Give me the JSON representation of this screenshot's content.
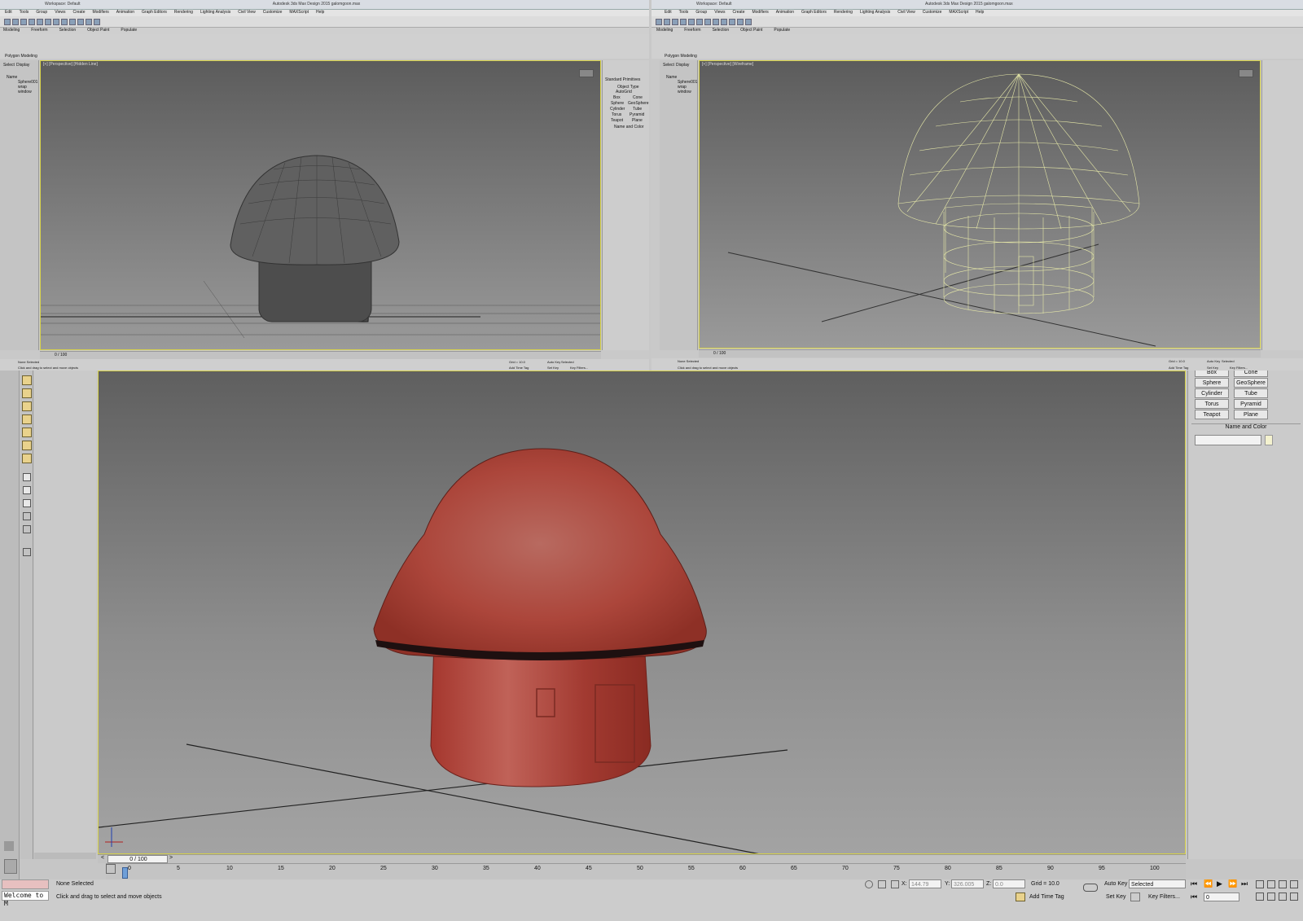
{
  "left_panel": {
    "title": "Autodesk 3ds Max Design 2015   galomgoon.max",
    "workspace": "Workspace: Default",
    "menus": [
      "Edit",
      "Tools",
      "Group",
      "Views",
      "Create",
      "Modifiers",
      "Animation",
      "Graph Editors",
      "Rendering",
      "Lighting Analysis",
      "Civil View",
      "Customize",
      "MAXScript",
      "Help"
    ],
    "ribbon_tabs": [
      "Modeling",
      "Freeform",
      "Selection",
      "Object Paint",
      "Populate"
    ],
    "ribbon_label": "Polygon Modeling",
    "scene_tabs": [
      "Select",
      "Display"
    ],
    "scene_header": "Name",
    "scene_items": [
      "Sphere001",
      "wrap window"
    ],
    "viewport_label": "[+] [Perspective] [Hidden Line]",
    "cmd_category": "Standard Primitives",
    "cmd_rollout": "Object Type",
    "cmd_autogrid": "AutoGrid",
    "cmd_buttons": [
      "Box",
      "Cone",
      "Sphere",
      "GeoSphere",
      "Cylinder",
      "Tube",
      "Torus",
      "Pyramid",
      "Teapot",
      "Plane"
    ],
    "cmd_namecolor": "Name and Color",
    "frame": "0 / 100",
    "status": "None Selected",
    "prompt": "Click and drag to select and move objects",
    "grid": "Grid = 10.0",
    "autokey": "Auto Key",
    "selected": "Selected",
    "setkey": "Set Key",
    "keyfilters": "Key Filters...",
    "timetag": "Add Time Tag"
  },
  "right_panel": {
    "title": "Autodesk 3ds Max Design 2015   galomgoon.max",
    "workspace": "Workspace: Default",
    "menus": [
      "Edit",
      "Tools",
      "Group",
      "Views",
      "Create",
      "Modifiers",
      "Animation",
      "Graph Editors",
      "Rendering",
      "Lighting Analysis",
      "Civil View",
      "Customize",
      "MAXScript",
      "Help"
    ],
    "ribbon_tabs": [
      "Modeling",
      "Freeform",
      "Selection",
      "Object Paint",
      "Populate"
    ],
    "ribbon_label": "Polygon Modeling",
    "scene_tabs": [
      "Select",
      "Display"
    ],
    "scene_header": "Name",
    "scene_items": [
      "Sphere001",
      "wrap window"
    ],
    "viewport_label": "[+] [Perspective] [Wireframe]",
    "frame": "0 / 100",
    "status": "None Selected",
    "prompt": "Click and drag to select and move objects",
    "grid": "Grid = 10.0",
    "autokey": "Auto Key",
    "selected": "Selected",
    "setkey": "Set Key",
    "keyfilters": "Key Filters...",
    "timetag": "Add Time Tag"
  },
  "bottom": {
    "cmd_buttons": [
      "Box",
      "Cone",
      "Sphere",
      "GeoSphere",
      "Cylinder",
      "Tube",
      "Torus",
      "Pyramid",
      "Teapot",
      "Plane"
    ],
    "name_and_color": "Name and Color",
    "frame": "0 / 100",
    "timeline_ticks": [
      "0",
      "5",
      "10",
      "15",
      "20",
      "25",
      "30",
      "35",
      "40",
      "45",
      "50",
      "55",
      "60",
      "65",
      "70",
      "75",
      "80",
      "85",
      "90",
      "95",
      "100"
    ],
    "maxscript_welcome": "Welcome to M",
    "status": "None Selected",
    "prompt": "Click and drag to select and move objects",
    "x_label": "X:",
    "x_value": "144.79",
    "y_label": "Y:",
    "y_value": "326.005",
    "z_label": "Z:",
    "z_value": "0.0",
    "grid": "Grid = 10.0",
    "autokey": "Auto Key",
    "selected": "Selected",
    "setkey": "Set Key",
    "keyfilters": "Key Filters...",
    "timetag": "Add Time Tag",
    "current_frame": "0"
  },
  "colors": {
    "viewport_border": "#d7d24a",
    "mushroom_red": "#b2483f",
    "wireframe": "#e6e8a8"
  }
}
